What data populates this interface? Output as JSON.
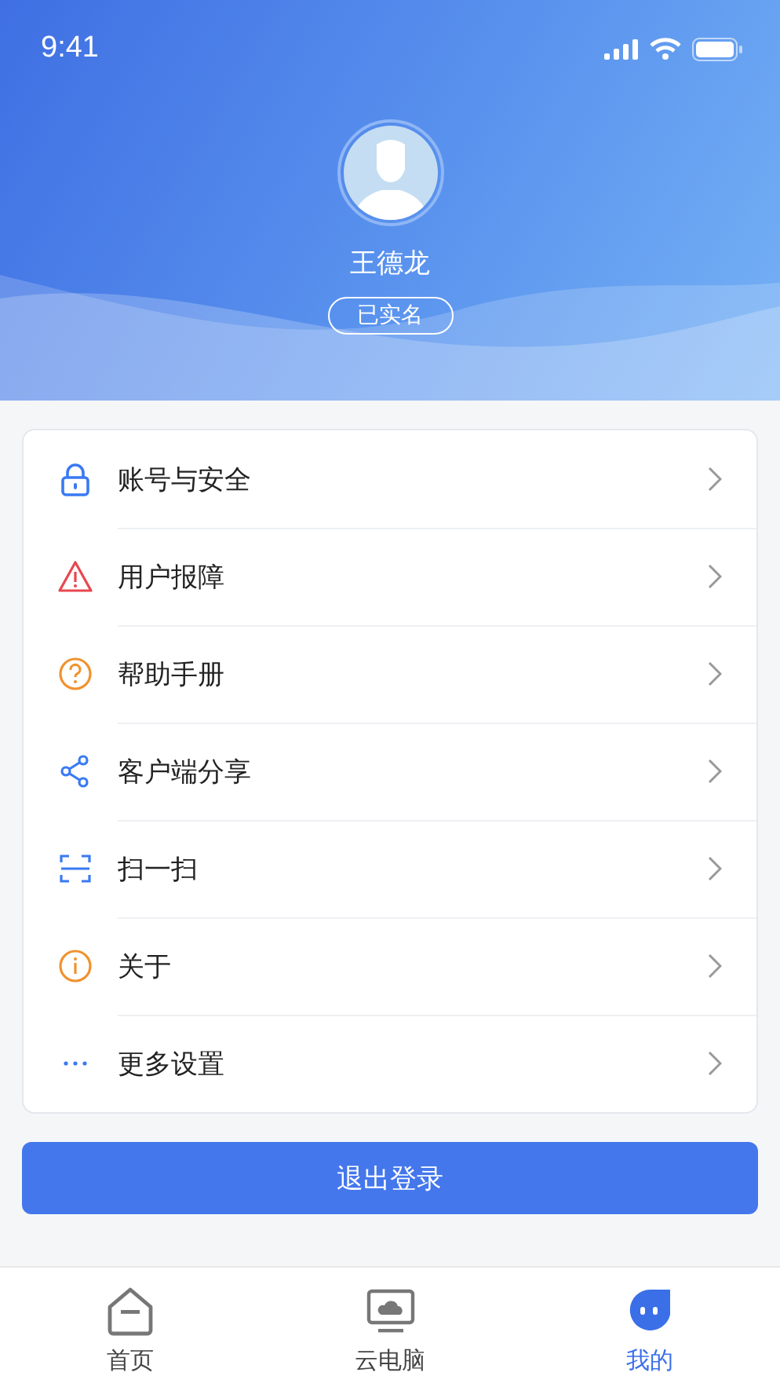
{
  "status_bar": {
    "time": "9:41"
  },
  "profile": {
    "name": "王德龙",
    "badge": "已实名"
  },
  "menu": [
    {
      "kind": "lock",
      "label": "账号与安全"
    },
    {
      "kind": "warning",
      "label": "用户报障"
    },
    {
      "kind": "help",
      "label": "帮助手册"
    },
    {
      "kind": "share",
      "label": "客户端分享"
    },
    {
      "kind": "scan",
      "label": "扫一扫"
    },
    {
      "kind": "info",
      "label": "关于"
    },
    {
      "kind": "more",
      "label": "更多设置"
    }
  ],
  "logout_button": "退出登录",
  "tab_bar": [
    {
      "kind": "home",
      "label": "首页",
      "selected": false
    },
    {
      "kind": "cloud",
      "label": "云电脑",
      "selected": false
    },
    {
      "kind": "mine",
      "label": "我的",
      "selected": true
    }
  ]
}
